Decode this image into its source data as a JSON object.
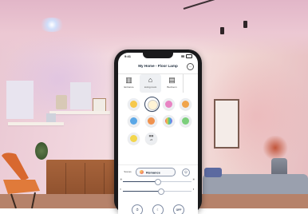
{
  "status_bar": {
    "time": "9:41"
  },
  "app": {
    "title": "My Home - Floor Lamp"
  },
  "rooms": [
    {
      "label": "Entrance",
      "icon": "entrance-icon"
    },
    {
      "label": "Living room",
      "icon": "sofa-icon",
      "active": true
    },
    {
      "label": "Bedroom",
      "icon": "bed-icon"
    }
  ],
  "scenes": {
    "extra_count_label": "+5",
    "items": [
      {
        "name": "scene-relax",
        "color": "#f6c84b"
      },
      {
        "name": "scene-read",
        "color": "#fff4d6",
        "selected": true
      },
      {
        "name": "scene-romance",
        "color": "#e883c3"
      },
      {
        "name": "scene-warm",
        "color": "#f0a54c"
      },
      {
        "name": "scene-ocean",
        "color": "#5aa7e6"
      },
      {
        "name": "scene-sunset",
        "color": "#f0924e"
      },
      {
        "name": "scene-rainbow",
        "color": "#8f7be0"
      },
      {
        "name": "scene-nature",
        "color": "#7ccf7b"
      },
      {
        "name": "scene-lightbulb",
        "color": "#f3d64d"
      },
      {
        "name": "scene-more",
        "color": "#e9ebef"
      }
    ]
  },
  "controls": {
    "mode_label": "Scenes",
    "current_scene": "Romance",
    "brightness": 0.5,
    "color_temperature": 0.55
  },
  "bottom_actions": [
    {
      "name": "timer-button",
      "glyph": "⏱"
    },
    {
      "name": "night-mode-button",
      "glyph": "☾"
    },
    {
      "name": "power-off-button",
      "label": "OFF"
    }
  ]
}
